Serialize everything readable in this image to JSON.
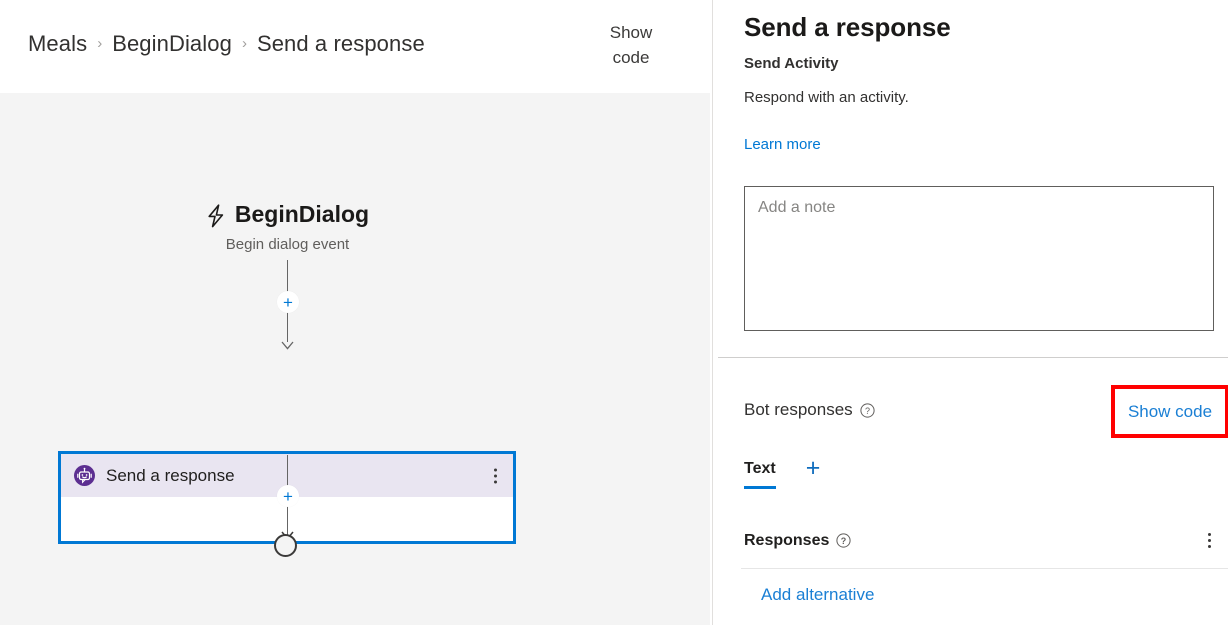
{
  "header": {
    "breadcrumb": [
      {
        "label": "Meals"
      },
      {
        "label": "BeginDialog"
      },
      {
        "label": "Send a response"
      }
    ],
    "separator": "›",
    "show_code_line1": "Show",
    "show_code_line2": "code"
  },
  "canvas": {
    "trigger": {
      "icon": "lightning-bolt-icon",
      "title": "BeginDialog",
      "subtitle": "Begin dialog event"
    },
    "add_node_label": "+",
    "action_node": {
      "icon": "bot-response-icon",
      "label": "Send a response",
      "menu_label": "⋮",
      "selected": true,
      "accent_color": "#0078d4",
      "header_color": "#e9e5f1",
      "icon_color": "#5c2e91"
    },
    "end_node_label": "end-node"
  },
  "panel": {
    "title": "Send a response",
    "subtitle": "Send Activity",
    "description": "Respond with an activity.",
    "learn_more": "Learn more",
    "note_placeholder": "Add a note",
    "note_value": "",
    "bot_responses_label": "Bot responses",
    "help_icon": "question-circle-icon",
    "show_code_link": "Show code",
    "highlight_color": "#ff0000",
    "link_color": "#1a7fd4",
    "tabs": [
      {
        "label": "Text",
        "active": true
      }
    ],
    "add_tab_label": "+",
    "responses_label": "Responses",
    "responses_menu_label": "⋮",
    "add_alternative": "Add alternative"
  }
}
